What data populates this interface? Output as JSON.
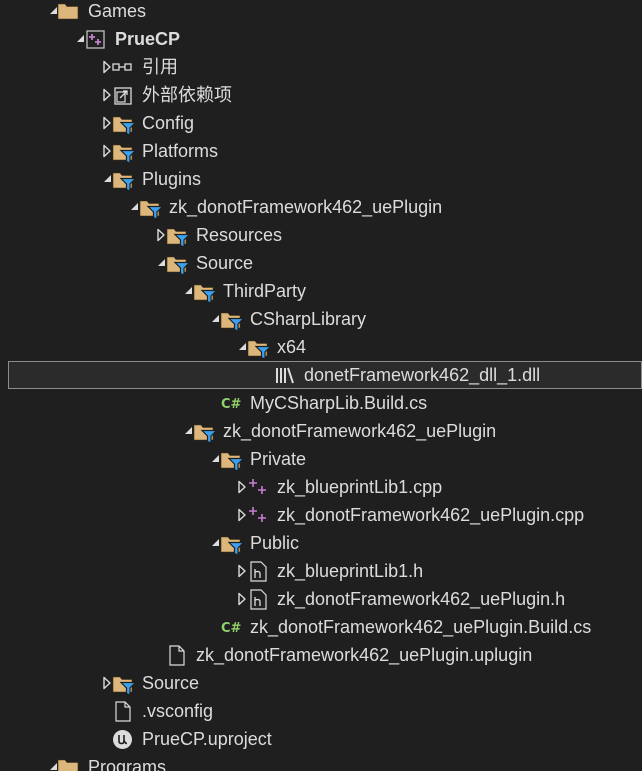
{
  "tree": [
    {
      "label": "Games",
      "expander": "open",
      "icon": "folder",
      "indent": 0
    },
    {
      "label": "PrueCP",
      "expander": "open",
      "icon": "cpp-project",
      "indent": 1,
      "bold": true
    },
    {
      "label": "引用",
      "expander": "closed",
      "icon": "references",
      "indent": 2
    },
    {
      "label": "外部依赖项",
      "expander": "closed",
      "icon": "external-dependencies",
      "indent": 2
    },
    {
      "label": "Config",
      "expander": "closed",
      "icon": "filter-folder",
      "indent": 2
    },
    {
      "label": "Platforms",
      "expander": "closed",
      "icon": "filter-folder",
      "indent": 2
    },
    {
      "label": "Plugins",
      "expander": "open",
      "icon": "filter-folder",
      "indent": 2
    },
    {
      "label": "zk_donotFramework462_uePlugin",
      "expander": "open",
      "icon": "filter-folder",
      "indent": 3
    },
    {
      "label": "Resources",
      "expander": "closed",
      "icon": "filter-folder",
      "indent": 4
    },
    {
      "label": "Source",
      "expander": "open",
      "icon": "filter-folder",
      "indent": 4
    },
    {
      "label": "ThirdParty",
      "expander": "open",
      "icon": "filter-folder",
      "indent": 5
    },
    {
      "label": "CSharpLibrary",
      "expander": "open",
      "icon": "filter-folder",
      "indent": 6
    },
    {
      "label": "x64",
      "expander": "open",
      "icon": "filter-folder",
      "indent": 7
    },
    {
      "label": "donetFramework462_dll_1.dll",
      "expander": "none",
      "icon": "library",
      "indent": 8,
      "selected": true
    },
    {
      "label": "MyCSharpLib.Build.cs",
      "expander": "none",
      "icon": "csharp-file",
      "indent": 6
    },
    {
      "label": "zk_donotFramework462_uePlugin",
      "expander": "open",
      "icon": "filter-folder",
      "indent": 5
    },
    {
      "label": "Private",
      "expander": "open",
      "icon": "filter-folder",
      "indent": 6
    },
    {
      "label": "zk_blueprintLib1.cpp",
      "expander": "closed",
      "icon": "cpp-file",
      "indent": 7
    },
    {
      "label": "zk_donotFramework462_uePlugin.cpp",
      "expander": "closed",
      "icon": "cpp-file",
      "indent": 7
    },
    {
      "label": "Public",
      "expander": "open",
      "icon": "filter-folder",
      "indent": 6
    },
    {
      "label": "zk_blueprintLib1.h",
      "expander": "closed",
      "icon": "header-file",
      "indent": 7
    },
    {
      "label": "zk_donotFramework462_uePlugin.h",
      "expander": "closed",
      "icon": "header-file",
      "indent": 7
    },
    {
      "label": "zk_donotFramework462_uePlugin.Build.cs",
      "expander": "none",
      "icon": "csharp-file",
      "indent": 6
    },
    {
      "label": "zk_donotFramework462_uePlugin.uplugin",
      "expander": "none",
      "icon": "file",
      "indent": 4
    },
    {
      "label": "Source",
      "expander": "closed",
      "icon": "filter-folder",
      "indent": 2
    },
    {
      "label": ".vsconfig",
      "expander": "none",
      "icon": "file",
      "indent": 2
    },
    {
      "label": "PrueCP.uproject",
      "expander": "none",
      "icon": "unreal-project",
      "indent": 2
    },
    {
      "label": "Programs",
      "expander": "open",
      "icon": "folder",
      "indent": 0
    }
  ],
  "colors": {
    "background": "#1f1f1f",
    "text": "#dcdcdc",
    "folder": "#dcb67a",
    "filter": "#3aa0f0",
    "cpp": "#c77dd2",
    "csharp": "#8fd16a",
    "selection_border": "#8c8c8c"
  }
}
